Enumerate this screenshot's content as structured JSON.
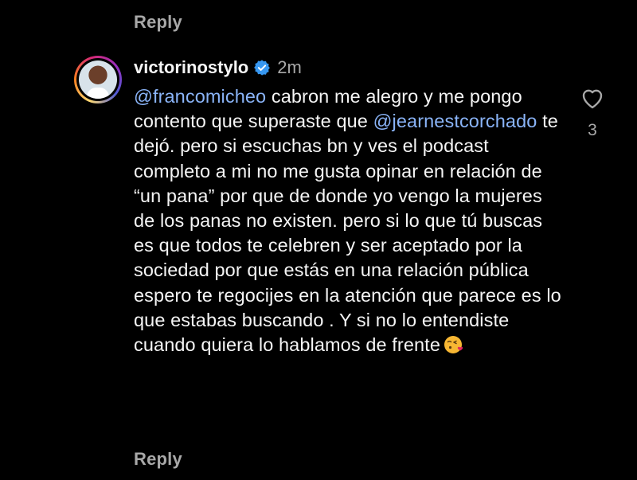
{
  "previous_comment": {
    "reply_label": "Reply"
  },
  "comment": {
    "username": "victorinostylo",
    "verified": true,
    "time": "2m",
    "mention_1": "@francomicheo",
    "text_1": " cabron me alegro y me pongo contento que superaste que ",
    "mention_2": "@jearnestcorchado",
    "text_2": " te dejó. pero si escuchas bn y ves el podcast completo a mi no me gusta opinar en relación de “un pana” por que de donde yo vengo la mujeres de los panas no existen. pero si lo que tú buscas es que todos te celebren y ser aceptado por la sociedad por que estás en una relación pública espero te regocijes en la atención que parece es lo que estabas buscando . Y si no lo entendiste cuando quiera lo hablamos de frente",
    "end_emoji": "face-blowing-a-kiss",
    "like_icon": "heart-outline-icon",
    "like_count": "3",
    "reply_label": "Reply"
  },
  "colors": {
    "background": "#000000",
    "text": "#f5f5f5",
    "secondary_text": "#a8a8a8",
    "mention": "#8ab4f8",
    "verified_badge": "#3797f0"
  }
}
